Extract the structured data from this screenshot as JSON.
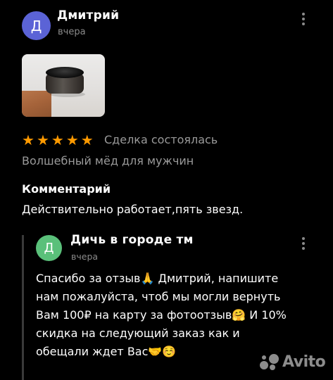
{
  "review": {
    "author_initial": "Д",
    "author_name": "Дмитрий",
    "date": "вчера",
    "rating": 5,
    "stars": [
      "★",
      "★",
      "★",
      "★",
      "★"
    ],
    "deal_status": "Сделка состоялась",
    "product_name": "Волшебный мёд для мужчин",
    "comment_heading": "Комментарий",
    "comment_text": "Действительно работает,пять звезд.",
    "colors": {
      "avatar": "#5b63d6",
      "star": "#ff9a00"
    }
  },
  "reply": {
    "author_initial": "Д",
    "author_name": "Дичь в городе тм",
    "date": "вчера",
    "text": "Спасибо за отзыв🙏 Дмитрий, напишите\nнам пожалуйста, чтоб мы могли вернуть\nВам 100₽ на карту за фотоотзыв🤗 И 10%\nскидка на следующий заказ как и\nобещали ждет Вас🤝☺️",
    "colors": {
      "avatar": "#5ac07a"
    }
  },
  "watermark": {
    "text": "Avito"
  },
  "icons": {
    "more": "more-vertical-icon",
    "photo": "product-photo",
    "logo": "avito-logo-icon"
  }
}
